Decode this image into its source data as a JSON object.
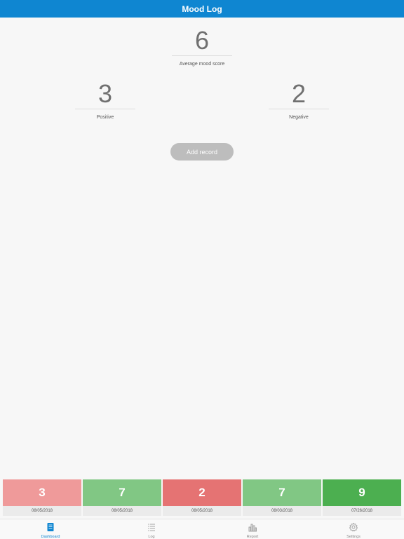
{
  "header": {
    "title": "Mood Log"
  },
  "stats": {
    "average": {
      "value": "6",
      "label": "Average mood score"
    },
    "positive": {
      "value": "3",
      "label": "Positive"
    },
    "negative": {
      "value": "2",
      "label": "Negative"
    }
  },
  "add_button": {
    "label": "Add record"
  },
  "entries": [
    {
      "score": "3",
      "date": "08/05/2018",
      "color": "#ef9a9a"
    },
    {
      "score": "7",
      "date": "08/05/2018",
      "color": "#81c784"
    },
    {
      "score": "2",
      "date": "08/05/2018",
      "color": "#e57373"
    },
    {
      "score": "7",
      "date": "08/03/2018",
      "color": "#81c784"
    },
    {
      "score": "9",
      "date": "07/26/2018",
      "color": "#4caf50"
    }
  ],
  "tabs": [
    {
      "label": "Dashboard",
      "icon": "dashboard-icon",
      "active": true
    },
    {
      "label": "Log",
      "icon": "list-icon",
      "active": false
    },
    {
      "label": "Report",
      "icon": "bar-chart-icon",
      "active": false
    },
    {
      "label": "Settings",
      "icon": "gear-icon",
      "active": false
    }
  ],
  "colors": {
    "accent": "#0f86d1",
    "inactive": "#8a8a8a"
  }
}
